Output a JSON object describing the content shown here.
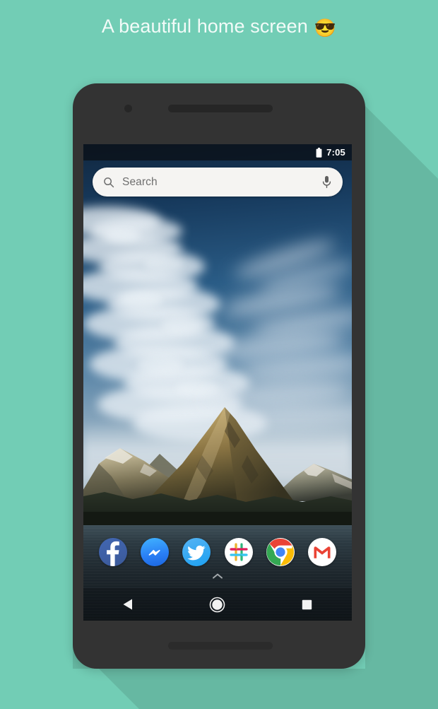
{
  "page": {
    "heading": "A beautiful home screen",
    "heading_emoji": "😎",
    "background_color": "#72cdb5",
    "shadow_color": "#66b8a2"
  },
  "phone": {
    "frame_color": "#333333",
    "camera_label": "front-camera",
    "earpiece_label": "earpiece-speaker",
    "bottom_speaker_label": "bottom-speaker-grille"
  },
  "statusbar": {
    "time": "7:05",
    "battery_icon": "battery-icon",
    "battery_level": "full"
  },
  "search": {
    "placeholder": "Search",
    "value": "",
    "search_icon": "search-icon",
    "mic_icon": "microphone-icon",
    "bar_color": "#f5f4f2"
  },
  "dock": {
    "apps": [
      {
        "name": "Facebook",
        "icon": "facebook-icon",
        "color": "#3b5998"
      },
      {
        "name": "Messenger",
        "icon": "messenger-icon",
        "color": "#0084ff"
      },
      {
        "name": "Twitter",
        "icon": "twitter-icon",
        "color": "#1da1f2"
      },
      {
        "name": "Slack",
        "icon": "slack-icon",
        "color": "#ffffff"
      },
      {
        "name": "Chrome",
        "icon": "chrome-icon",
        "color": "#ffffff"
      },
      {
        "name": "Gmail",
        "icon": "gmail-icon",
        "color": "#ffffff"
      }
    ]
  },
  "drawer": {
    "handle_icon": "chevron-up-icon"
  },
  "navbar": {
    "buttons": [
      {
        "name": "Back",
        "icon": "back-triangle-icon"
      },
      {
        "name": "Home",
        "icon": "home-circle-icon"
      },
      {
        "name": "Recents",
        "icon": "recents-square-icon"
      }
    ]
  },
  "wallpaper": {
    "scene": "mountain-lake-landscape",
    "sky_color": "#16395c",
    "water_color": "#1d262c",
    "peak_color": "#a58a50"
  }
}
